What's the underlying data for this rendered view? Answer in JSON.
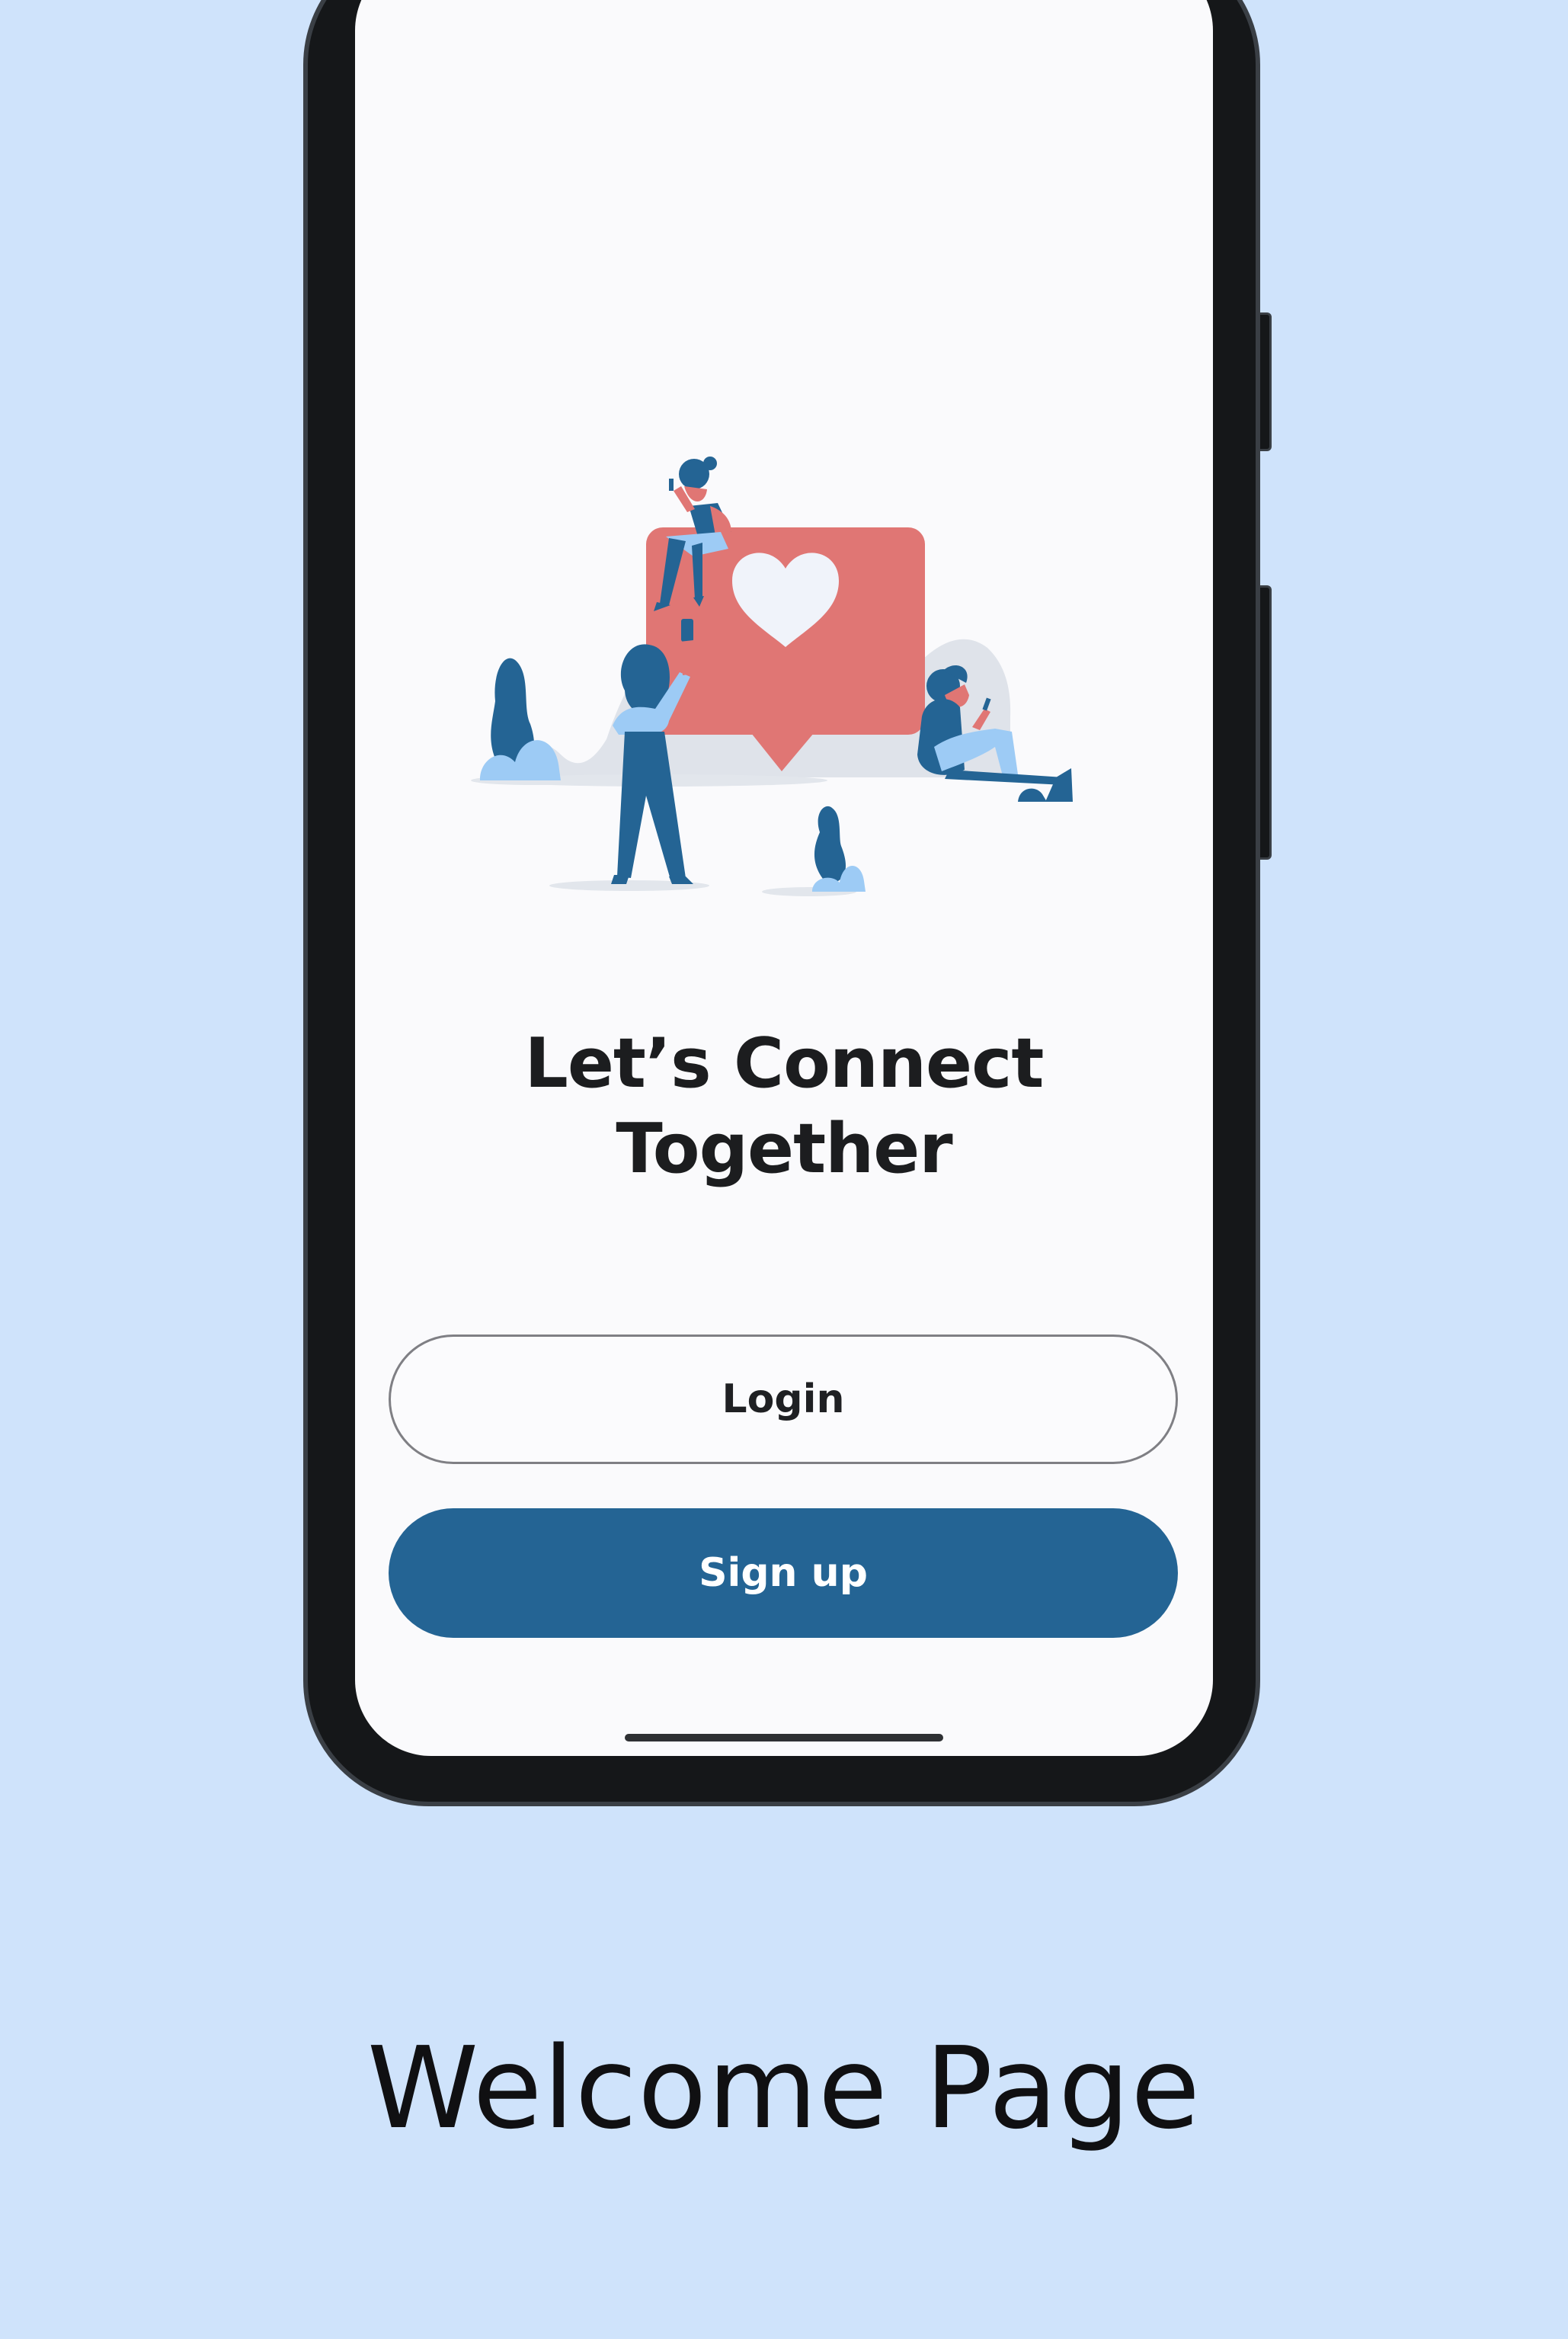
{
  "welcome": {
    "headline_line1": "Let’s Connect",
    "headline_line2": "Together",
    "login_label": "Login",
    "signup_label": "Sign up"
  },
  "caption": "Welcome Page",
  "illustration": {
    "icons": [
      "heart-speech-bubble-icon",
      "person-sitting-icon",
      "person-standing-icon",
      "person-lounging-icon",
      "plant-icon"
    ]
  },
  "colors": {
    "background": "#cfe3fb",
    "primary": "#246494",
    "accent_red": "#e07674",
    "light_blue": "#9dcbf5",
    "screen_bg": "#fafafc",
    "text": "#1c1d1f"
  }
}
